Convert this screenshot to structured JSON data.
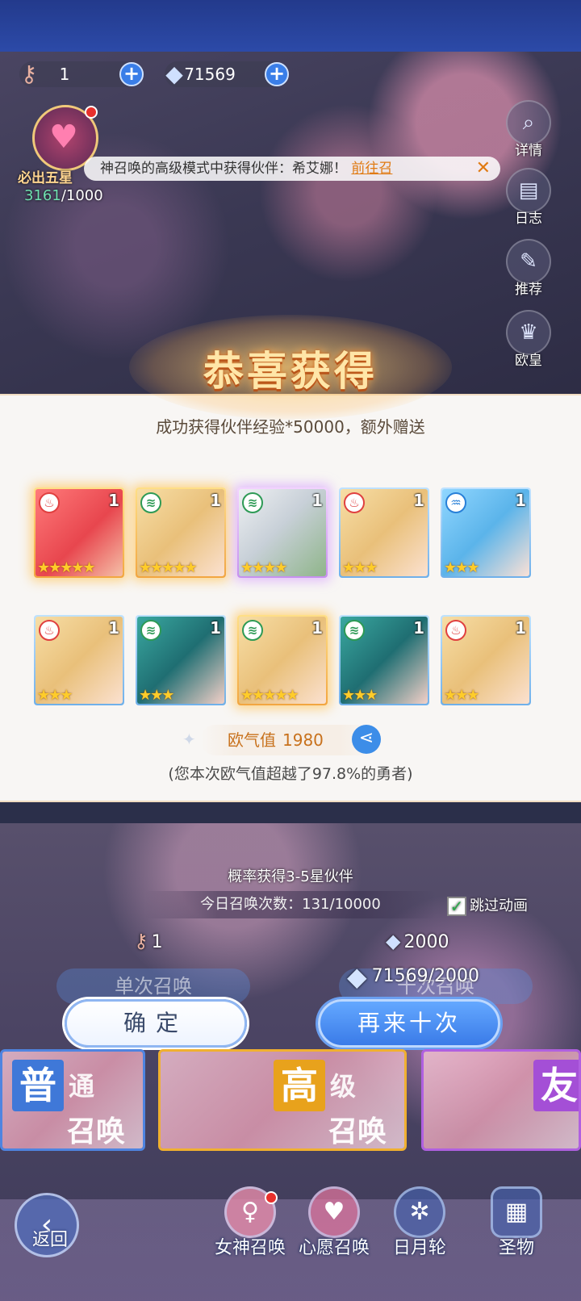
{
  "resources": {
    "tickets": "1",
    "gems": "71569"
  },
  "guarantee": {
    "label": "必出五星",
    "current": "3161",
    "total": "/1000"
  },
  "ticker": {
    "text": "神召唤的高级模式中获得伙伴：希艾娜！",
    "link": "前往召",
    "close": "✕"
  },
  "side_buttons": [
    "详情",
    "日志",
    "推荐",
    "欧皇"
  ],
  "result": {
    "title": "恭喜获得",
    "subtitle": "成功获得伙伴经验*50000，额外赠送",
    "cards": [
      {
        "element": "fire",
        "count": "1",
        "stars": 5,
        "quality": "gold",
        "portrait": "red"
      },
      {
        "element": "wind",
        "count": "1",
        "stars": 5,
        "quality": "gold",
        "portrait": "blonde"
      },
      {
        "element": "wind",
        "count": "1",
        "stars": 4,
        "quality": "purple",
        "portrait": "white"
      },
      {
        "element": "fire",
        "count": "1",
        "stars": 3,
        "quality": "blue",
        "portrait": "blonde"
      },
      {
        "element": "water",
        "count": "1",
        "stars": 3,
        "quality": "blue",
        "portrait": "cyan"
      },
      {
        "element": "fire",
        "count": "1",
        "stars": 3,
        "quality": "blue",
        "portrait": "blonde"
      },
      {
        "element": "wind",
        "count": "1",
        "stars": 3,
        "quality": "blue",
        "portrait": "teal"
      },
      {
        "element": "wind",
        "count": "1",
        "stars": 5,
        "quality": "gold",
        "portrait": "blonde"
      },
      {
        "element": "wind",
        "count": "1",
        "stars": 3,
        "quality": "blue",
        "portrait": "teal"
      },
      {
        "element": "fire",
        "count": "1",
        "stars": 3,
        "quality": "blue",
        "portrait": "blonde"
      }
    ],
    "luck_label": "欧气值",
    "luck_value": "1980",
    "luck_note": "(您本次欧气值超越了97.8%的勇者)"
  },
  "summon": {
    "rate_text": "概率获得3-5星伙伴",
    "today_count": "今日召唤次数：131/10000",
    "skip_label": "跳过动画",
    "single_cost": "1",
    "ten_cost": "2000",
    "single_label_ghost": "单次召唤",
    "ten_label_ghost": "十次召唤",
    "gem_balance": "71569/2000"
  },
  "buttons": {
    "confirm": "确定",
    "again": "再来十次"
  },
  "banners": [
    {
      "big": "普",
      "top": "通",
      "bottom": "召唤",
      "color": "#3f78d8"
    },
    {
      "big": "高",
      "top": "级",
      "bottom": "召唤",
      "color": "#e8a21c"
    },
    {
      "big": "友",
      "top": "",
      "bottom": "",
      "color": "#a44fd6"
    }
  ],
  "nav": {
    "back": "返回",
    "items": [
      "女神召唤",
      "心愿召唤",
      "日月轮",
      "圣物"
    ]
  }
}
